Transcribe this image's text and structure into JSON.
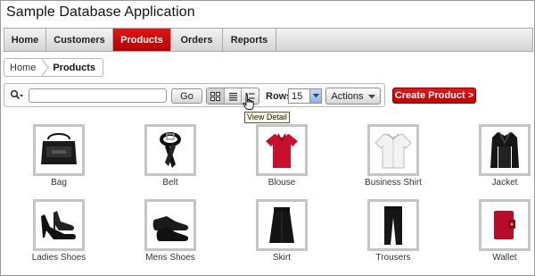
{
  "app": {
    "title": "Sample Database Application"
  },
  "nav": {
    "tabs": [
      {
        "label": "Home"
      },
      {
        "label": "Customers"
      },
      {
        "label": "Products",
        "active": true
      },
      {
        "label": "Orders"
      },
      {
        "label": "Reports"
      }
    ]
  },
  "breadcrumb": {
    "items": [
      "Home",
      "Products"
    ]
  },
  "toolbar": {
    "search_value": "",
    "go_label": "Go",
    "rows_label": "Rows",
    "rows_value": "15",
    "actions_label": "Actions",
    "view_tooltip": "View Detail",
    "icons": [
      "search-icon",
      "icon-view-icon",
      "report-view-icon",
      "detail-view-icon"
    ]
  },
  "create_button": {
    "label": "Create Product >"
  },
  "products": [
    {
      "name": "Bag"
    },
    {
      "name": "Belt"
    },
    {
      "name": "Blouse"
    },
    {
      "name": "Business Shirt"
    },
    {
      "name": "Jacket"
    },
    {
      "name": "Ladies Shoes"
    },
    {
      "name": "Mens Shoes"
    },
    {
      "name": "Skirt"
    },
    {
      "name": "Trousers"
    },
    {
      "name": "Wallet"
    }
  ],
  "colors": {
    "accent": "#cc0000",
    "tab_bar": "#dcdcdc",
    "thumb_border": "#c5c5c5",
    "tooltip_bg": "#ffffe1"
  }
}
